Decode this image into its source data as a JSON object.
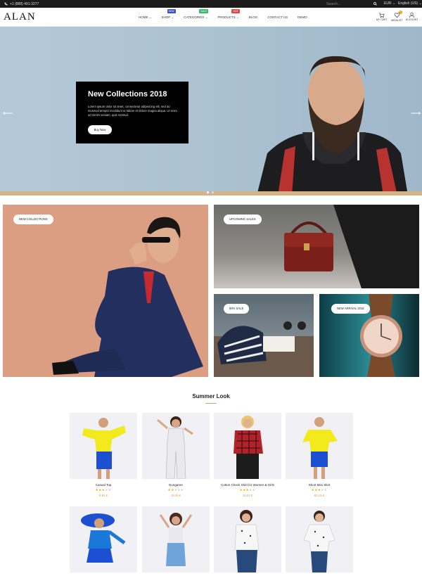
{
  "topbar": {
    "phone": "+1 (888) 491-3277",
    "search_placeholder": "Search...",
    "currency": "EUR",
    "language": "English (US)"
  },
  "header": {
    "logo": "ALAN",
    "nav": [
      {
        "label": "HOME",
        "chevron": "⌄",
        "badge": ""
      },
      {
        "label": "SHOP",
        "chevron": "⌄",
        "badge": "NEW",
        "badge_color": "#3b4fd6"
      },
      {
        "label": "CATEGORIES",
        "chevron": "⌄",
        "badge": "SALE",
        "badge_color": "#2fbf6a"
      },
      {
        "label": "PRODUCTS",
        "chevron": "⌄",
        "badge": "HOT",
        "badge_color": "#e04747"
      },
      {
        "label": "BLOG",
        "chevron": "",
        "badge": ""
      },
      {
        "label": "CONTACT US",
        "chevron": "",
        "badge": ""
      },
      {
        "label": "DEMO",
        "chevron": "",
        "badge": ""
      }
    ],
    "cart_label": "MY CART",
    "wishlist_label": "WISHLIST",
    "wishlist_count": "0",
    "account_label": "ACCOUNT"
  },
  "hero": {
    "title": "New Collections 2018",
    "text": "Lorem ipsum dolor sit amet, consectetur adipisicing elit, sed do eiusmod tempor incididunt ut labore et dolore magna aliqua. Ut enim ad minim veniam, quis nostrud.",
    "button": "Buy Now"
  },
  "banners": {
    "new_collections": "NEW COLLECTIONS",
    "upcoming_sales": "UPCOMING SALES",
    "sale": "50% SALE",
    "new_arrival": "NEW ARRIVAL 2018"
  },
  "section": {
    "title": "Summer Look"
  },
  "products": [
    {
      "name": "Casual Top",
      "rating": 3,
      "price": "8.81 €"
    },
    {
      "name": "Dungaree",
      "rating": 2,
      "price": "15.06 €"
    },
    {
      "name": "Cotton Check Shirt for Women & Girls",
      "rating": 3,
      "price": "19.52 €"
    },
    {
      "name": "Short Mini Skirt",
      "rating": 3,
      "price": "83.41 €"
    }
  ],
  "colors": {
    "accent": "#d6a56b",
    "star": "#f1a500",
    "price": "#e29a4a"
  }
}
